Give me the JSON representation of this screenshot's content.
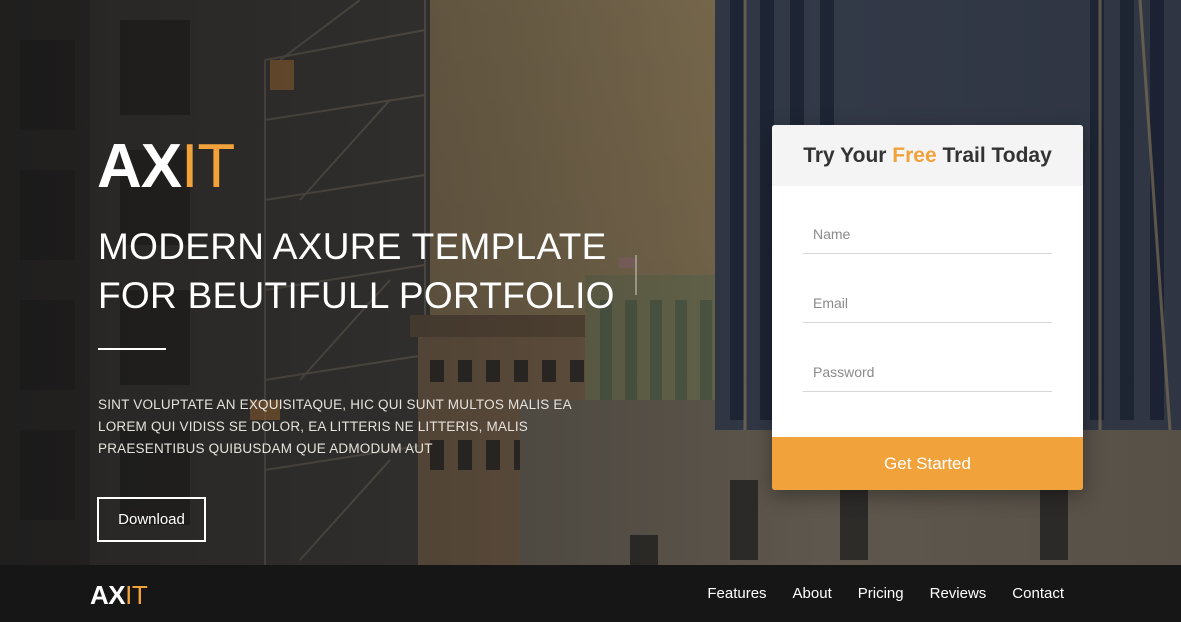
{
  "brand": {
    "logo_main": "AX",
    "logo_accent": "IT"
  },
  "hero": {
    "headline_line1": "MODERN AXURE TEMPLATE",
    "headline_line2": "FOR BEUTIFULL PORTFOLIO",
    "description": "SINT VOLUPTATE AN EXQUISITAQUE, HIC QUI SUNT MULTOS MALIS EA LOREM QUI VIDISS SE DOLOR, EA LITTERIS NE LITTERIS, MALIS PRAESENTIBUS QUIBUSDAM QUE ADMODUM AUT",
    "download_label": "Download"
  },
  "signup": {
    "title_before": "Try Your ",
    "title_accent": "Free",
    "title_after": " Trail Today",
    "name_placeholder": "Name",
    "email_placeholder": "Email",
    "password_placeholder": "Password",
    "submit_label": "Get Started"
  },
  "footer": {
    "nav": [
      {
        "label": "Features"
      },
      {
        "label": "About"
      },
      {
        "label": "Pricing"
      },
      {
        "label": "Reviews"
      },
      {
        "label": "Contact"
      }
    ]
  },
  "colors": {
    "accent": "#f1a23b",
    "footer_bg": "#161616",
    "button_text": "#ffffff"
  }
}
